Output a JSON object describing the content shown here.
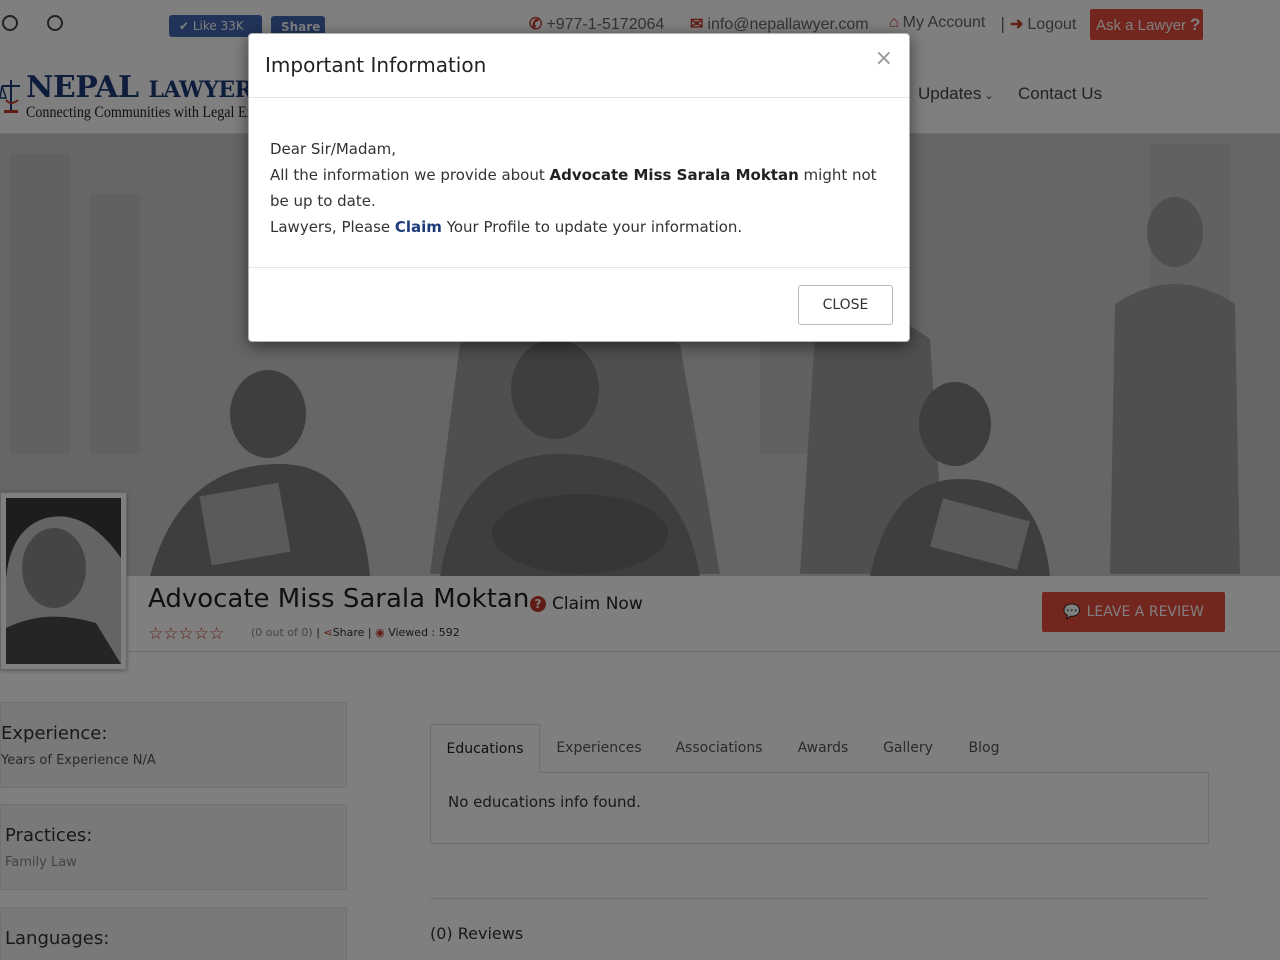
{
  "topbar": {
    "fb_like": "✔ Like 33K",
    "fb_share": "Share",
    "phone": "+977-1-5172064",
    "email": "info@nepallawyer.com",
    "my_account": "My Account",
    "separator": "|",
    "logout": "Logout",
    "ask_lawyer": "Ask a Lawyer"
  },
  "logo": {
    "name_big": "NEPAL",
    "name_small": "LAWYER",
    "tagline": "Connecting Communities with Legal Experts"
  },
  "nav": {
    "updates": "Updates",
    "contact": "Contact Us"
  },
  "profile": {
    "name": "Advocate Miss Sarala Moktan",
    "claim_now": "Claim Now",
    "stars": "☆☆☆☆☆",
    "rating_text": "(0 out of 0)",
    "share": "Share",
    "viewed": "Viewed : 592",
    "leave_review": "LEAVE A REVIEW"
  },
  "sidebar": {
    "experience_title": "Experience:",
    "experience_value": "Years of Experience N/A",
    "practices_title": "Practices:",
    "practices_value": "Family Law",
    "languages_title": "Languages:"
  },
  "tabs": {
    "items": [
      "Educations",
      "Experiences",
      "Associations",
      "Awards",
      "Gallery",
      "Blog"
    ],
    "empty_text": "No educations info found."
  },
  "reviews": {
    "title": "(0) Reviews"
  },
  "modal": {
    "title": "Important Information",
    "close_x": "×",
    "greeting": "Dear Sir/Madam,",
    "line1_pre": "All the information we provide about ",
    "line1_name": "Advocate Miss Sarala Moktan",
    "line1_post": " might not be up to date.",
    "line2_pre": "Lawyers, Please ",
    "line2_claim": "Claim",
    "line2_post": " Your Profile to update your information.",
    "close_button": "CLOSE"
  },
  "colors": {
    "brand_red": "#e74c3c",
    "brand_blue": "#1e3b7a",
    "facebook": "#4267b2"
  }
}
